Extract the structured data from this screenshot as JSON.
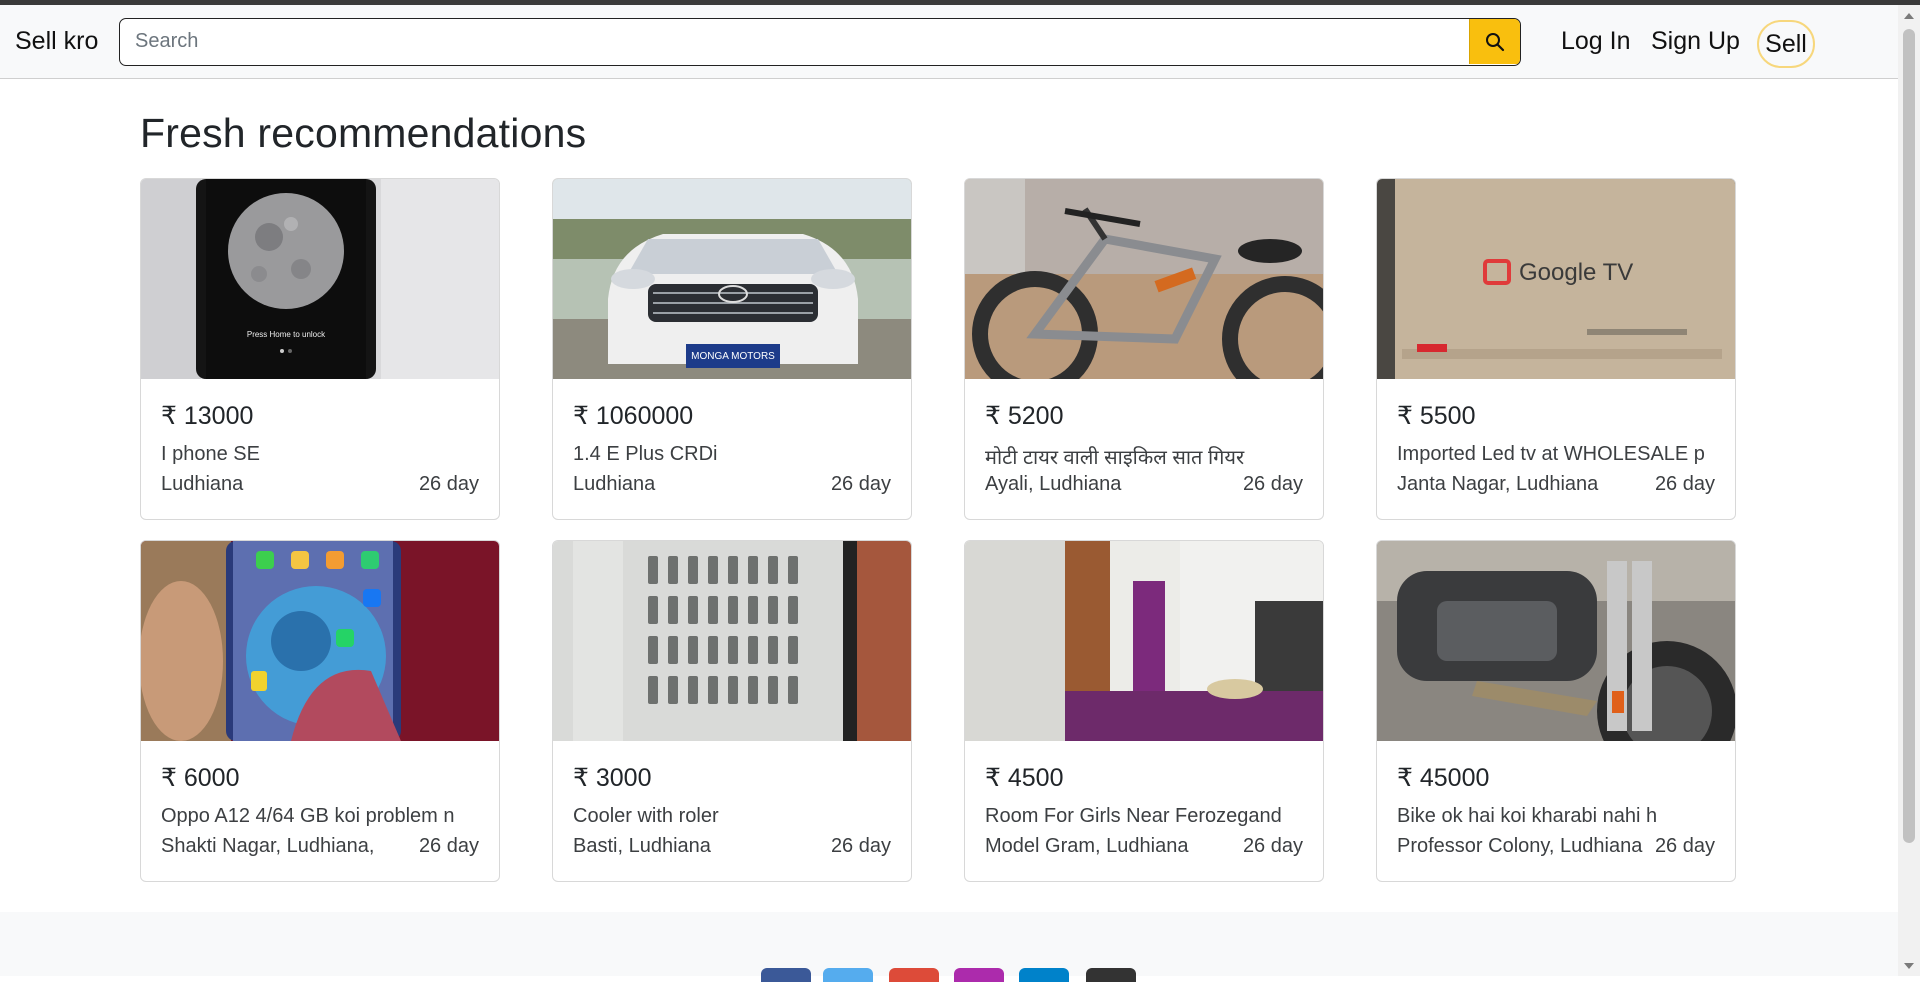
{
  "nav": {
    "brand": "Sell kro",
    "search_placeholder": "Search",
    "login": "Log In",
    "signup": "Sign Up",
    "sell": "Sell",
    "accent": "#f9bf0e"
  },
  "section_title": "Fresh recommendations",
  "listings": [
    {
      "price": "₹ 13000",
      "title": "I phone SE",
      "location": "Ludhiana",
      "age": "26 day",
      "image": "phone-moon-image"
    },
    {
      "price": "₹ 1060000",
      "title": "1.4 E Plus CRDi",
      "location": "Ludhiana",
      "age": "26 day",
      "image": "white-car-image"
    },
    {
      "price": "₹ 5200",
      "title": "मोटी टायर वाली साइकिल सात गियर",
      "location": "Ayali, Ludhiana",
      "age": "26 day",
      "image": "bicycle-image"
    },
    {
      "price": "₹ 5500",
      "title": "Imported Led tv at WHOLESALE p",
      "location": "Janta Nagar, Ludhiana",
      "age": "26 day",
      "image": "google-tv-box-image"
    },
    {
      "price": "₹ 6000",
      "title": "Oppo A12 4/64 GB koi problem n",
      "location": "Shakti Nagar, Ludhiana,",
      "age": "26 day",
      "image": "oppo-phone-image"
    },
    {
      "price": "₹ 3000",
      "title": "Cooler with roler",
      "location": "Basti, Ludhiana",
      "age": "26 day",
      "image": "cooler-image"
    },
    {
      "price": "₹ 4500",
      "title": "Room For Girls Near Ferozegand",
      "location": "Model Gram, Ludhiana",
      "age": "26 day",
      "image": "room-image"
    },
    {
      "price": "₹ 45000",
      "title": "Bike ok hai koi kharabi nahi h",
      "location": "Professor Colony, Ludhiana",
      "age": "26 day",
      "image": "motorbike-image"
    }
  ],
  "thumb_text": {
    "phone_unlock": "Press Home to unlock",
    "plate": "MONGA MOTORS",
    "tv_brand": "Google TV"
  },
  "footer_social_colors": [
    "#3b5998",
    "#55acee",
    "#dd4b39",
    "#ac2bac",
    "#0082ca",
    "#333333"
  ]
}
